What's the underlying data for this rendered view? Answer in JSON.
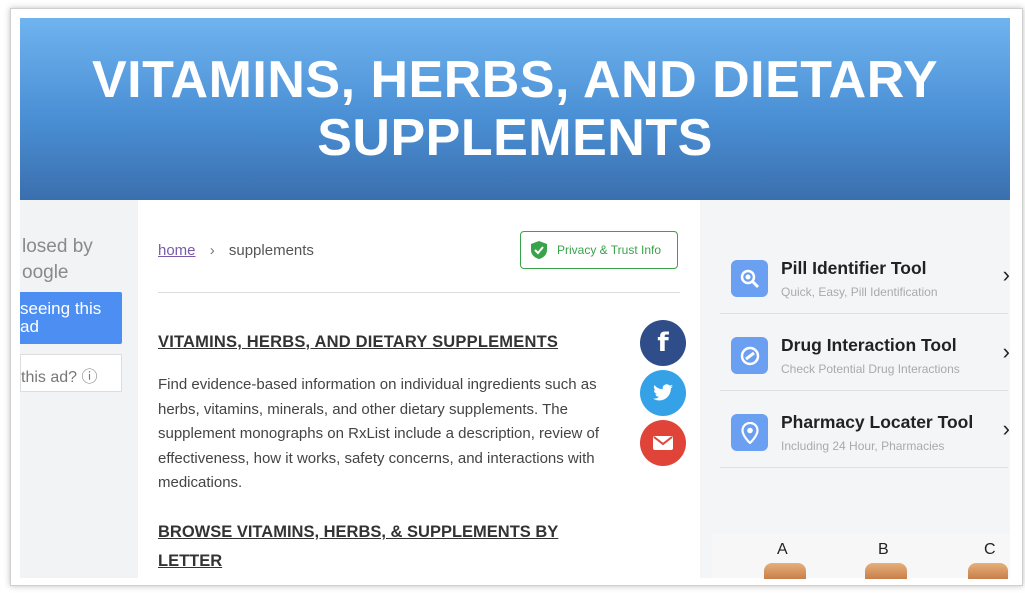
{
  "banner": {
    "title": "VITAMINS, HERBS, AND DIETARY SUPPLEMENTS"
  },
  "ad": {
    "closed_by_line1": "losed by",
    "closed_by_line2": "oogle",
    "stop_button": "seeing this ad",
    "why_label": "this ad? ⓘ"
  },
  "breadcrumb": {
    "home": "home",
    "separator": "›",
    "current": "supplements"
  },
  "privacy": {
    "label": "Privacy & Trust Info"
  },
  "content": {
    "heading": "VITAMINS, HERBS, AND DIETARY SUPPLEMENTS",
    "description": "Find evidence-based information on individual ingredients such as herbs, vitamins, minerals, and other dietary supplements. The supplement monographs on RxList include a description, review of effectiveness, how it works, safety concerns, and interactions with medications.",
    "browse_heading": "BROWSE VITAMINS, HERBS, & SUPPLEMENTS BY LETTER"
  },
  "social": {
    "facebook": "f",
    "twitter": "🐦",
    "email": "✉"
  },
  "tools": [
    {
      "name": "Pill Identifier Tool",
      "sub": "Quick, Easy, Pill Identification",
      "icon": "pill-search-icon"
    },
    {
      "name": "Drug Interaction Tool",
      "sub": "Check Potential Drug Interactions",
      "icon": "drug-interaction-icon"
    },
    {
      "name": "Pharmacy Locater Tool",
      "sub": "Including 24 Hour, Pharmacies",
      "icon": "location-pin-icon"
    }
  ],
  "tool_arrow": "›",
  "letters": [
    "A",
    "B",
    "C"
  ],
  "colors": {
    "banner_top": "#6fb3ef",
    "banner_bottom": "#3a6fae",
    "privacy_green": "#39a34a",
    "tool_icon_bg": "#6b9ff2"
  }
}
